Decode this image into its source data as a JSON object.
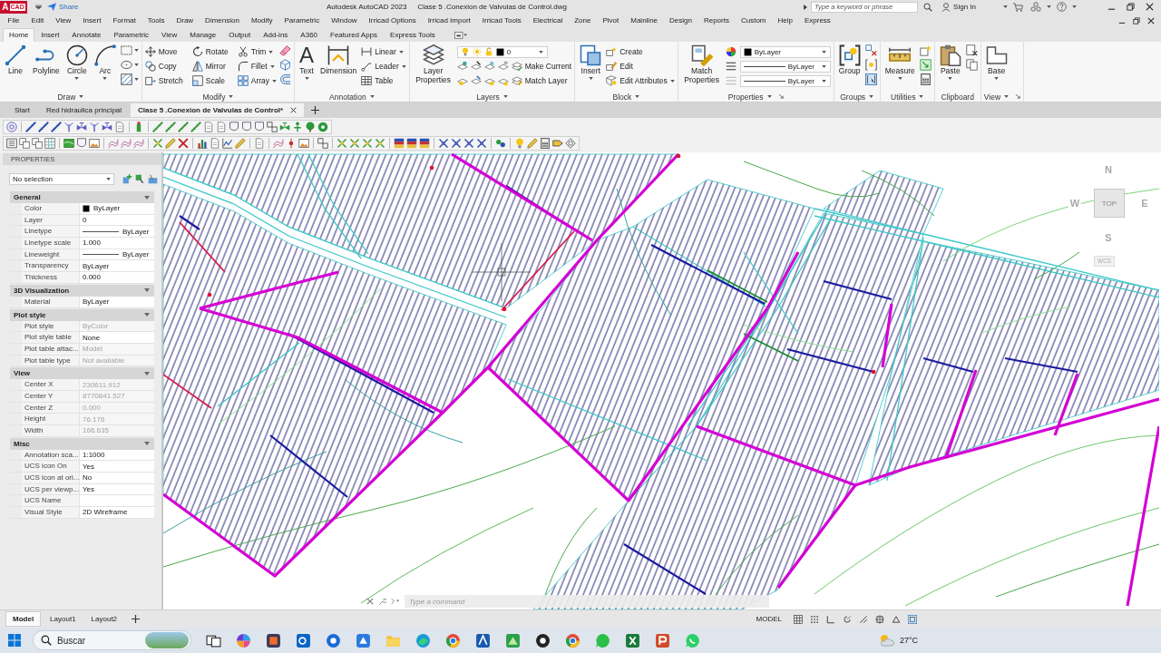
{
  "title_bar": {
    "logo": {
      "letter": "A",
      "text": "CAD"
    },
    "share": "Share",
    "app_name": "Autodesk AutoCAD 2023",
    "file_name": "Clase 5 .Conexion de Valvulas de Control.dwg",
    "search": {
      "placeholder": "Type a keyword or phrase"
    },
    "sign_in": "Sign In"
  },
  "menu_bar": [
    "File",
    "Edit",
    "View",
    "Insert",
    "Format",
    "Tools",
    "Draw",
    "Dimension",
    "Modify",
    "Parametric",
    "Window",
    "Irricad Options",
    "Irricad Import",
    "Irricad Tools",
    "Electrical",
    "Zone",
    "Pivot",
    "Mainline",
    "Design",
    "Reports",
    "Custom",
    "Help",
    "Express"
  ],
  "ribbon_tabs": [
    {
      "label": "Home",
      "selected": true
    },
    {
      "label": "Insert",
      "selected": false
    },
    {
      "label": "Annotate",
      "selected": false
    },
    {
      "label": "Parametric",
      "selected": false
    },
    {
      "label": "View",
      "selected": false
    },
    {
      "label": "Manage",
      "selected": false
    },
    {
      "label": "Output",
      "selected": false
    },
    {
      "label": "Add-ins",
      "selected": false
    },
    {
      "label": "A360",
      "selected": false
    },
    {
      "label": "Featured Apps",
      "selected": false
    },
    {
      "label": "Express Tools",
      "selected": false
    }
  ],
  "ribbon_panels": [
    {
      "title": "Draw",
      "has_menu": true,
      "launcher": false,
      "tools": [
        {
          "label": "Line",
          "kind": "large",
          "has_menu": false
        },
        {
          "label": "Polyline",
          "kind": "large",
          "has_menu": false
        },
        {
          "label": "Circle",
          "kind": "large",
          "has_menu": true
        },
        {
          "label": "Arc",
          "kind": "large",
          "has_menu": true
        }
      ]
    },
    {
      "title": "Modify",
      "has_menu": true,
      "launcher": false,
      "tools": [
        {
          "label": "Move",
          "kind": "small",
          "has_menu": false
        },
        {
          "label": "Rotate",
          "kind": "small",
          "has_menu": false
        },
        {
          "label": "Trim",
          "kind": "small",
          "has_menu": true
        },
        {
          "label": "Copy",
          "kind": "small",
          "has_menu": false
        },
        {
          "label": "Mirror",
          "kind": "small",
          "has_menu": false
        },
        {
          "label": "Fillet",
          "kind": "small",
          "has_menu": true
        },
        {
          "label": "Stretch",
          "kind": "small",
          "has_menu": false
        },
        {
          "label": "Scale",
          "kind": "small",
          "has_menu": false
        },
        {
          "label": "Array",
          "kind": "small",
          "has_menu": true
        }
      ]
    },
    {
      "title": "Annotation",
      "has_menu": true,
      "launcher": false,
      "tools": [
        {
          "label": "Text",
          "kind": "large",
          "has_menu": true,
          "glyph": "A"
        },
        {
          "label": "Dimension",
          "kind": "large",
          "has_menu": false
        },
        {
          "label": "Linear",
          "kind": "small",
          "has_menu": true
        },
        {
          "label": "Leader",
          "kind": "small",
          "has_menu": true
        },
        {
          "label": "Table",
          "kind": "small",
          "has_menu": false
        }
      ]
    },
    {
      "title": "Layers",
      "has_menu": true,
      "launcher": false,
      "tools": [
        {
          "label": "Layer Properties",
          "kind": "large",
          "has_menu": false
        },
        {
          "value": "0",
          "kind": "layer_dropdown"
        },
        {
          "label": "Make Current",
          "kind": "small",
          "has_menu": false
        },
        {
          "label": "Match Layer",
          "kind": "small",
          "has_menu": false
        }
      ]
    },
    {
      "title": "Block",
      "has_menu": true,
      "launcher": false,
      "tools": [
        {
          "label": "Insert",
          "kind": "large",
          "has_menu": true
        },
        {
          "label": "Create",
          "kind": "small",
          "has_menu": false
        },
        {
          "label": "Edit",
          "kind": "small",
          "has_menu": false
        },
        {
          "label": "Edit Attributes",
          "kind": "small",
          "has_menu": true
        }
      ]
    },
    {
      "title": "Properties",
      "has_menu": true,
      "launcher": true,
      "tools": [
        {
          "label": "Match Properties",
          "kind": "large",
          "has_menu": false
        },
        {
          "value": "ByLayer",
          "kind": "color_dropdown"
        },
        {
          "value": "ByLayer",
          "kind": "linetype_dropdown"
        },
        {
          "value": "ByLayer",
          "kind": "lineweight_dropdown"
        }
      ]
    },
    {
      "title": "Groups",
      "has_menu": true,
      "launcher": false,
      "tools": [
        {
          "label": "Group",
          "kind": "large",
          "has_menu": false
        }
      ]
    },
    {
      "title": "Utilities",
      "has_menu": true,
      "launcher": false,
      "tools": [
        {
          "label": "Measure",
          "kind": "large",
          "has_menu": true
        }
      ]
    },
    {
      "title": "Clipboard",
      "has_menu": false,
      "launcher": false,
      "tools": [
        {
          "label": "Paste",
          "kind": "large",
          "has_menu": true
        }
      ]
    },
    {
      "title": "View",
      "has_menu": true,
      "launcher": true,
      "tools": [
        {
          "label": "Base",
          "kind": "large",
          "has_menu": true
        }
      ]
    }
  ],
  "file_tabs": [
    {
      "label": "Start",
      "selected": false
    },
    {
      "label": "Red hidraulica principal",
      "selected": false
    },
    {
      "label": "Clase 5 .Conexion de Valvulas de Control*",
      "selected": true
    }
  ],
  "properties_panel": {
    "title": "PROPERTIES",
    "selection": "No selection",
    "sections": [
      {
        "title": "General",
        "expanded": true,
        "rows": [
          {
            "label": "Color",
            "value": "ByLayer",
            "kind": "swatch",
            "disabled": false
          },
          {
            "label": "Layer",
            "value": "0",
            "kind": "text",
            "disabled": false
          },
          {
            "label": "Linetype",
            "value": "ByLayer",
            "kind": "line",
            "disabled": false
          },
          {
            "label": "Linetype scale",
            "value": "1.000",
            "kind": "text",
            "disabled": false
          },
          {
            "label": "Lineweight",
            "value": "ByLayer",
            "kind": "line",
            "disabled": false
          },
          {
            "label": "Transparency",
            "value": "ByLayer",
            "kind": "text",
            "disabled": false
          },
          {
            "label": "Thickness",
            "value": "0.000",
            "kind": "text",
            "disabled": false
          }
        ]
      },
      {
        "title": "3D Visualization",
        "expanded": true,
        "rows": [
          {
            "label": "Material",
            "value": "ByLayer",
            "kind": "text",
            "disabled": false
          }
        ]
      },
      {
        "title": "Plot style",
        "expanded": true,
        "rows": [
          {
            "label": "Plot style",
            "value": "ByColor",
            "kind": "text",
            "disabled": true
          },
          {
            "label": "Plot style table",
            "value": "None",
            "kind": "text",
            "disabled": false
          },
          {
            "label": "Plot table attac...",
            "value": "Model",
            "kind": "text",
            "disabled": true
          },
          {
            "label": "Plot table type",
            "value": "Not available",
            "kind": "text",
            "disabled": true
          }
        ]
      },
      {
        "title": "View",
        "expanded": true,
        "rows": [
          {
            "label": "Center X",
            "value": "230611.912",
            "kind": "text",
            "disabled": true
          },
          {
            "label": "Center Y",
            "value": "8770841.527",
            "kind": "text",
            "disabled": true
          },
          {
            "label": "Center Z",
            "value": "0.000",
            "kind": "text",
            "disabled": true
          },
          {
            "label": "Height",
            "value": "76.176",
            "kind": "text",
            "disabled": true
          },
          {
            "label": "Width",
            "value": "166.635",
            "kind": "text",
            "disabled": true
          }
        ]
      },
      {
        "title": "Misc",
        "expanded": true,
        "rows": [
          {
            "label": "Annotation sca...",
            "value": "1:1000",
            "kind": "text",
            "disabled": false
          },
          {
            "label": "UCS icon On",
            "value": "Yes",
            "kind": "text",
            "disabled": false
          },
          {
            "label": "UCS icon at ori...",
            "value": "No",
            "kind": "text",
            "disabled": false
          },
          {
            "label": "UCS per viewp...",
            "value": "Yes",
            "kind": "text",
            "disabled": false
          },
          {
            "label": "UCS Name",
            "kind": "text",
            "disabled": false
          },
          {
            "label": "Visual Style",
            "value": "2D Wireframe",
            "kind": "text",
            "disabled": false
          }
        ]
      }
    ]
  },
  "viewcube": {
    "north": "N",
    "west": "W",
    "east": "E",
    "south": "S",
    "face": "TOP",
    "ucs": "WCS"
  },
  "command_line": {
    "placeholder": "Type a command"
  },
  "layout_tabs": [
    {
      "label": "Model",
      "selected": true
    },
    {
      "label": "Layout1",
      "selected": false
    },
    {
      "label": "Layout2",
      "selected": false
    }
  ],
  "status_bar": {
    "mode": "MODEL"
  },
  "taskbar": {
    "search": {
      "placeholder": "Buscar"
    },
    "weather": "27°C"
  }
}
